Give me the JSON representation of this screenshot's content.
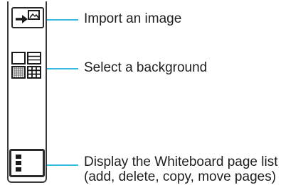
{
  "callouts": [
    {
      "id": "import",
      "icon": "import-image-icon",
      "text": "Import an image"
    },
    {
      "id": "background",
      "icon": "background-grid-icon",
      "text": "Select a background"
    },
    {
      "id": "pagelist",
      "icon": "page-list-icon",
      "lines": [
        "Display the Whiteboard page list",
        "(add, delete, copy, move pages)"
      ]
    }
  ],
  "colors": {
    "callout_line": "#38b8e0",
    "icon_stroke": "#2a2a2a"
  }
}
